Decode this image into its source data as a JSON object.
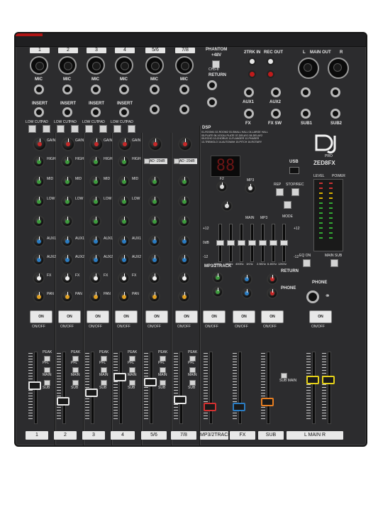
{
  "brand": {
    "logo_text": "DJ",
    "logo_sub": "PRO",
    "model": "ZED8FX"
  },
  "channels": [
    "1",
    "2",
    "3",
    "4",
    "5/6",
    "7/8"
  ],
  "top_labels": {
    "phantom": "PHANTOM",
    "phantom_v": "+48V",
    "ch_range": "CH5-8",
    "return": "RETURN",
    "ztrk_in": "2TRK IN",
    "rec_out": "REC OUT",
    "main_out": "MAIN OUT",
    "l": "L",
    "r": "R",
    "aux1": "AUX1",
    "aux2": "AUX2",
    "fx": "FX",
    "fx_sw": "FX SW",
    "sub1": "SUB1",
    "sub2": "SUB2"
  },
  "strip_labels": {
    "mic": "MIC",
    "insert": "INSERT",
    "low_cut": "LOW CUT",
    "pad": "PAD",
    "gain": "GAIN",
    "pad_20": "PAD\n-20dB",
    "high": "HIGH",
    "mid": "MID",
    "low": "LOW",
    "aux1": "AUX1",
    "aux2": "AUX2",
    "fx": "FX",
    "pan": "PAN",
    "on": "ON",
    "on_off": "ON/OFF",
    "peak": "PEAK",
    "pfl": "PFL",
    "main": "MAIN",
    "sub": "SUB",
    "48v": "+48V"
  },
  "fx_section": {
    "title": "DSP",
    "presets": [
      "01-ROOM1",
      "02-ROOM2",
      "03-SMALL HALL",
      "04-LARGE HALL",
      "05-PLATE",
      "06-VOCAL PLATE",
      "07-DELAY1",
      "08-DELAY2",
      "09-ECHO",
      "10-CHORUS",
      "11-FLANGER",
      "12-PHASER",
      "13-TREMOLO",
      "14-AUTOWAH",
      "15-PITCH",
      "16-ROTARY"
    ],
    "display": "88",
    "f2": "F2",
    "mp3": "MP3",
    "main_mp3": "MAIN",
    "mp3_lbl": "MP3",
    "rep": "REP",
    "stop_rec": "STOP/REC",
    "mode": "MODE",
    "usb": "USB"
  },
  "geq": {
    "bands": [
      "63Hz",
      "160Hz",
      "400Hz",
      "1KHz",
      "2.5KHz",
      "6.4KHz",
      "12KHz"
    ],
    "scale_top": "+12",
    "scale_mid": "0dB",
    "scale_bot": "-12",
    "levels": [
      0.5,
      0.5,
      0.5,
      0.5,
      0.5,
      0.5,
      0.5
    ]
  },
  "master_labels": {
    "mp3_2track": "MP3/2TRACK",
    "return": "RETURN",
    "phone": "PHONE",
    "eq_on": "EQ ON",
    "main_sub": "MAIN SUB",
    "level": "LEVEL",
    "pwr": "PWR",
    "power": "POWER",
    "sub_main": "SUB\nMAIN"
  },
  "bottom_labels": [
    "1",
    "2",
    "3",
    "4",
    "5/6",
    "7/8",
    "MP3/2TRACK",
    "FX",
    "SUB",
    "L  MAIN  R"
  ],
  "colors": {
    "panel": "#2c2c2e",
    "gain_knob": "#c62828",
    "eq_high": "#3d9b3d",
    "eq_mid": "#3d9b3d",
    "eq_low": "#3d9b3d",
    "aux_knob": "#2a7cc2",
    "fx_knob": "#f2f2f2",
    "pan_knob": "#e0a021",
    "mp3_fader": "#d23030",
    "fx_fader": "#2a7cc2",
    "sub_fader": "#e67e22",
    "main_fader": "#e6d21a"
  }
}
